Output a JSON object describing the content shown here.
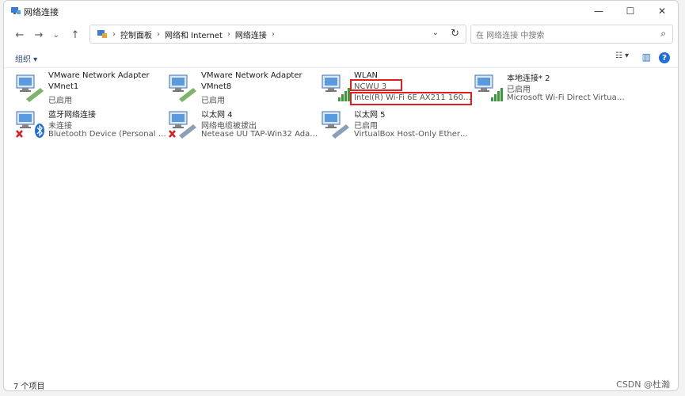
{
  "window": {
    "title": "网络连接"
  },
  "controls": {
    "min": "—",
    "max": "☐",
    "close": "✕"
  },
  "nav": {
    "back": "←",
    "forward": "→",
    "recent": "⌄",
    "up": "↑"
  },
  "address": {
    "crumbs": [
      "控制面板",
      "网络和 Internet",
      "网络连接"
    ],
    "sep": "›",
    "drop": "⌄",
    "refresh": "↻"
  },
  "search": {
    "placeholder": "在 网络连接 中搜索",
    "icon": "⌕"
  },
  "toolbar": {
    "organize": "组织 ▾",
    "view": "☷ ▾",
    "pane": "▥",
    "help": "?"
  },
  "items": [
    {
      "name": "VMware Network Adapter",
      "line2": "VMnet1",
      "line3": "已启用",
      "status": "ok"
    },
    {
      "name": "VMware Network Adapter",
      "line2": "VMnet8",
      "line3": "已启用",
      "status": "ok"
    },
    {
      "name": "WLAN",
      "line2": "NCWU 3",
      "line3": "Intel(R) Wi-Fi 6E AX211 160M...",
      "status": "wifi"
    },
    {
      "name": "本地连接* 2",
      "line2": "已启用",
      "line3": "Microsoft Wi-Fi Direct Virtual ...",
      "status": "wifi"
    },
    {
      "name": "蓝牙网络连接",
      "line2": "未连接",
      "line3": "Bluetooth Device (Personal Are...",
      "status": "bt"
    },
    {
      "name": "以太网 4",
      "line2": "网络电缆被拔出",
      "line3": "Netease UU TAP-Win32 Adapt...",
      "status": "off"
    },
    {
      "name": "以太网 5",
      "line2": "已启用",
      "line3": "VirtualBox Host-Only Ethernet ...",
      "status": "ok"
    }
  ],
  "status": {
    "count": "7 个项目"
  },
  "watermark": "CSDN @杜瀚"
}
